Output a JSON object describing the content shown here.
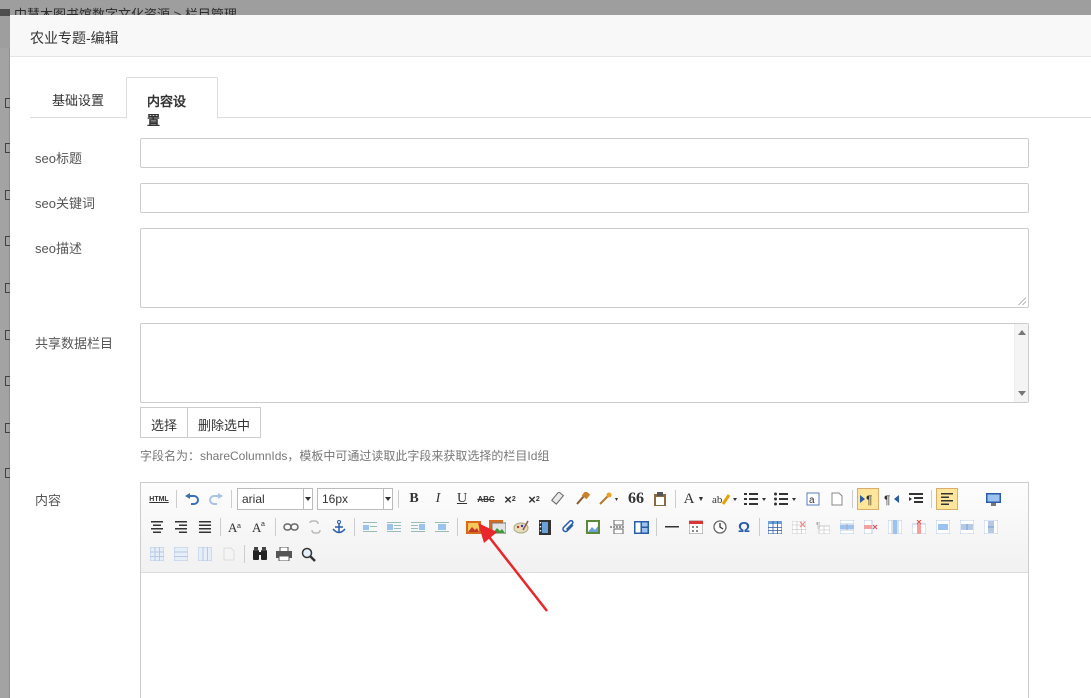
{
  "background": {
    "breadcrumb": "中慧木图书馆数字文化资源 > 栏目管理"
  },
  "modal": {
    "title": "农业专题-编辑",
    "tabs": [
      {
        "label": "基础设置",
        "active": false
      },
      {
        "label": "内容设置",
        "active": true
      }
    ],
    "fields": {
      "seo_title_label": "seo标题",
      "seo_keywords_label": "seo关键词",
      "seo_desc_label": "seo描述",
      "shared_columns_label": "共享数据栏目",
      "content_label": "内容"
    },
    "buttons": {
      "select": "选择",
      "delete_selected": "删除选中"
    },
    "hint": "字段名为：shareColumnIds，模板中可通过读取此字段来获取选择的栏目Id组",
    "editor": {
      "html_button": "HTML",
      "font_family": "arial",
      "font_size": "16px",
      "bold": "B",
      "italic": "I",
      "underline": "U",
      "strike": "ABC",
      "quote": "66",
      "font_color": "A",
      "omega": "Ω"
    }
  },
  "colors": {
    "accent_arrow": "#e8262b",
    "selected_button": "#ffe69a"
  }
}
